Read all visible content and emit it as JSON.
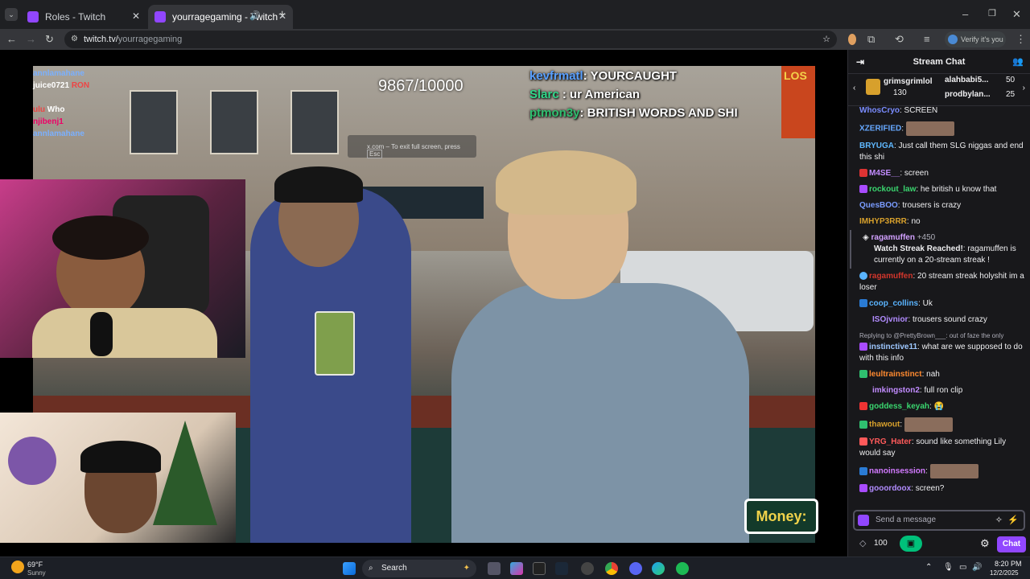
{
  "browser": {
    "tabs": [
      {
        "title": "Roles - Twitch",
        "active": false
      },
      {
        "title": "yourragegaming - Twitch",
        "active": true
      }
    ],
    "url_host": "twitch.tv/",
    "url_path": "yourragegaming",
    "verify_label": "Verify it's you"
  },
  "video": {
    "counter": "9867/10000",
    "fullscreen_note": "x.com – To exit full screen, press",
    "fullscreen_key": "Esc",
    "overlay_chat": [
      {
        "user": "kevfrmatl",
        "text": ": YOURCAUGHT",
        "color": "#5aa0ff"
      },
      {
        "user": "Slarc",
        "text": " : ur American",
        "color": "#30d98a"
      },
      {
        "user": "ptmon3y",
        "text": ": BRITISH WORDS AND SHI",
        "color": "#2fbf6f"
      }
    ],
    "money_label": "Money:",
    "top_left_names": [
      "annlamahane",
      "juice0721",
      "RON",
      "ulu",
      "Who",
      "njibenj1",
      "annlamahane"
    ]
  },
  "chat": {
    "header": "Stream Chat",
    "pins": [
      {
        "name": "grimsgrimlol",
        "count": "130"
      },
      {
        "name": "alahbabi5...",
        "count": "50"
      },
      {
        "name": "prodbylan...",
        "count": "25"
      }
    ],
    "messages": [
      {
        "user": "WhosCryo",
        "text": ": SCREEN",
        "color": "#7a8cff"
      },
      {
        "user": "XZERIFIED",
        "text": ":",
        "color": "#66a8ff",
        "emote": true
      },
      {
        "user": "BRYUGA",
        "text": ": Just call them SLG niggas and end this shi",
        "color": "#5fb8ff"
      },
      {
        "user": "M4SE__",
        "text": ": screen",
        "color": "#c28cff"
      },
      {
        "user": "rockout_law",
        "text": ": he british u know that",
        "color": "#3ad66f"
      },
      {
        "user": "QuesBOO",
        "text": ": trousers is crazy",
        "color": "#7a9cff"
      },
      {
        "user": "IMHYP3RRR",
        "text": ": no",
        "color": "#d7a02c"
      },
      {
        "user": "ragamuffen",
        "text": "+450",
        "color": "#d2a1ff",
        "streak": true,
        "streak_title": "Watch Streak Reached!",
        "streak_body": ": ragamuffen is currently on a 20-stream streak !"
      },
      {
        "user": "ragamuffen",
        "text": ": 20 stream streak holyshit im a loser",
        "color": "#d2362c"
      },
      {
        "user": "coop_collins",
        "text": ": Uk",
        "color": "#5ab4ff"
      },
      {
        "user": "ISOjvnior",
        "text": ": trousers sound crazy",
        "color": "#b28cff"
      },
      {
        "user": "instinctive11",
        "text": ": what are we supposed to do with this info",
        "color": "#9ec8ff",
        "reply": "Replying to @PrettyBrown___: out of faze the only"
      },
      {
        "user": "leultrainstinct",
        "text": ": nah",
        "color": "#ff8a30"
      },
      {
        "user": "imkingston2",
        "text": ": full ron clip",
        "color": "#c28cff"
      },
      {
        "user": "goddess_keyah",
        "text": ":",
        "color": "#3ad66f"
      },
      {
        "user": "thawout",
        "text": ":",
        "color": "#d7a02c",
        "emote": true
      },
      {
        "user": "YRG_Hater",
        "text": ": sound like something Lily would say",
        "color": "#ff5a5a"
      },
      {
        "user": "nanoinsession",
        "text": ":",
        "color": "#d27aff",
        "emote": true
      },
      {
        "user": "gooordoox",
        "text": ": screen?",
        "color": "#b28cff"
      }
    ],
    "input_placeholder": "Send a message",
    "points": "100",
    "chat_button": "Chat"
  },
  "taskbar": {
    "weather_temp": "69°F",
    "weather_desc": "Sunny",
    "search_label": "Search",
    "time": "8:20 PM",
    "date": "12/2/2025"
  }
}
